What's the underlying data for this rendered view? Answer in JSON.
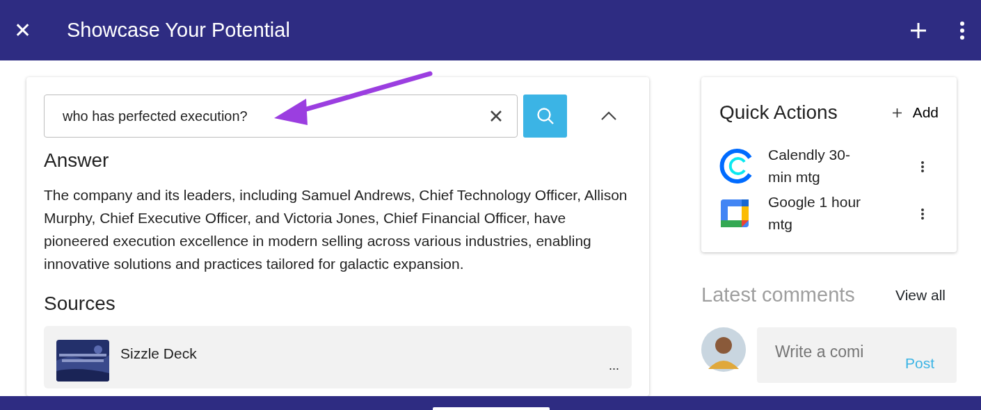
{
  "header": {
    "title": "Showcase Your Potential",
    "close_icon": "✕"
  },
  "search": {
    "value": "who has perfected execution?"
  },
  "answer": {
    "heading": "Answer",
    "text": "The company and its leaders, including Samuel Andrews, Chief Technology Officer, Allison Murphy, Chief Executive Officer, and Victoria Jones, Chief Financial Officer, have pioneered execution excellence in modern selling across various industries, enabling innovative solutions and practices tailored for galactic expansion."
  },
  "sources": {
    "heading": "Sources",
    "items": [
      {
        "title": "Sizzle Deck",
        "menu": "..."
      }
    ]
  },
  "quick_actions": {
    "title": "Quick Actions",
    "add_label": "Add",
    "items": [
      {
        "kind": "calendly",
        "label": "Calendly 30-min mtg"
      },
      {
        "kind": "google",
        "label": "Google 1 hour mtg"
      }
    ]
  },
  "comments": {
    "title": "Latest comments",
    "view_all": "View all",
    "placeholder": "Write a comi",
    "post": "Post"
  }
}
